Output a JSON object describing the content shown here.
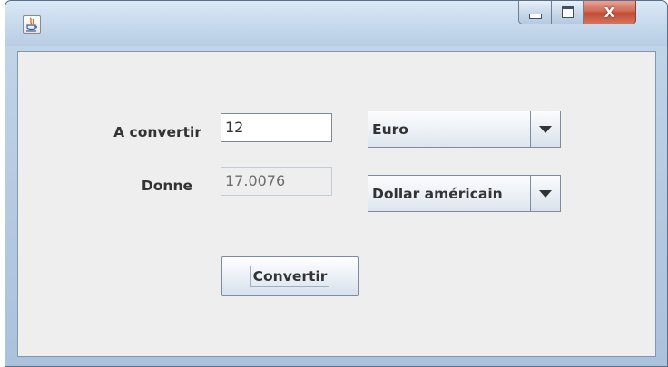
{
  "window": {
    "title": "",
    "controls": {
      "minimize_icon": "minimize-icon",
      "maximize_icon": "maximize-icon",
      "close_icon": "close-icon",
      "close_glyph": "X"
    },
    "app_icon": "java-icon"
  },
  "form": {
    "input_label": "A convertir",
    "input_value": "12",
    "output_label": "Donne",
    "output_value": "17.0076",
    "from_currency": {
      "selected": "Euro",
      "arrow_icon": "dropdown-arrow-icon"
    },
    "to_currency": {
      "selected": "Dollar américain",
      "arrow_icon": "dropdown-arrow-icon"
    },
    "convert_button": "Convertir"
  },
  "colors": {
    "window_frame": "#b9cde3",
    "content_bg": "#eeeeee",
    "close_button": "#c24a34"
  }
}
